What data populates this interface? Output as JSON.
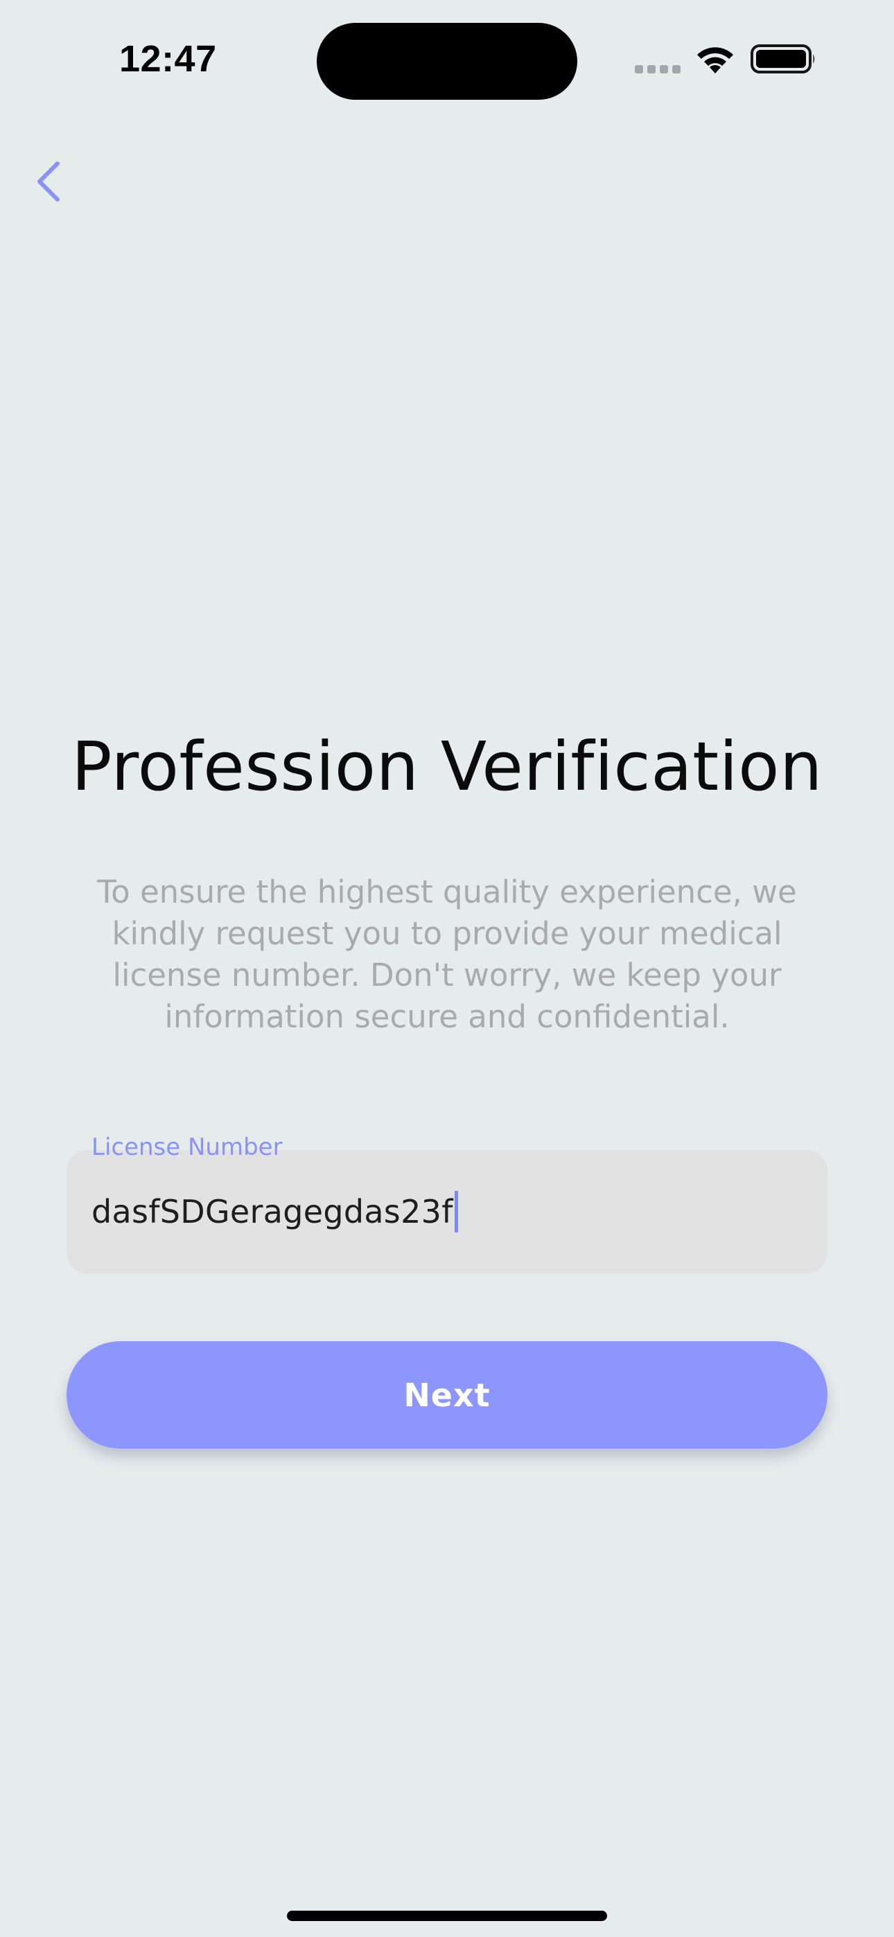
{
  "status_bar": {
    "time": "12:47"
  },
  "header": {
    "back_icon": "chevron-left-icon"
  },
  "main": {
    "title": "Profession Verification",
    "description": "To ensure the highest quality experience, we kindly request you to provide your medical license number. Don't worry, we keep your information secure and confidential.",
    "license_field": {
      "label": "License Number",
      "value": "dasfSDGeragegdas23f"
    },
    "next_label": "Next"
  },
  "colors": {
    "accent": "#8d96fc",
    "label_accent": "#8a93f5",
    "background": "#e6ebec",
    "field_background": "#e2e2e3",
    "description_text": "#a9aaab"
  }
}
